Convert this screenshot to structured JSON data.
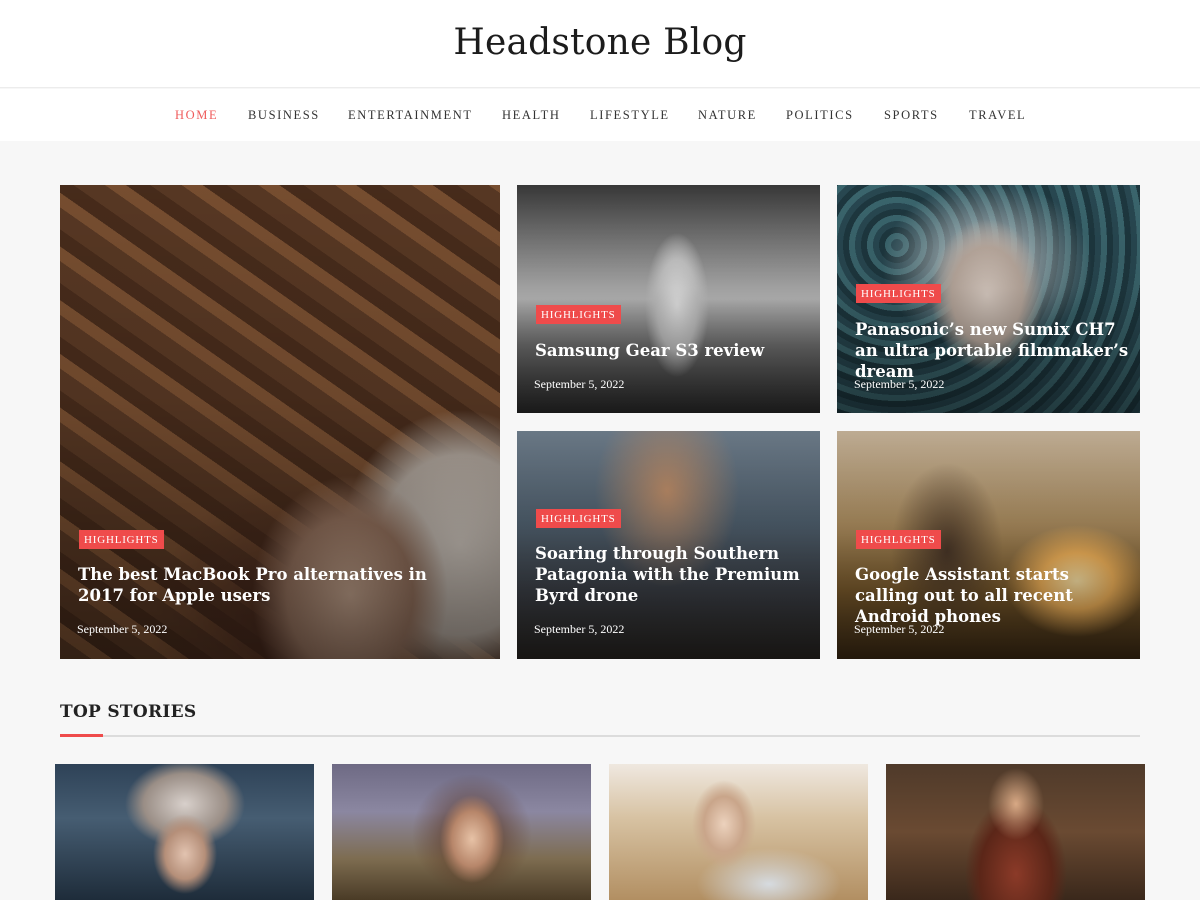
{
  "site": {
    "title": "Headstone Blog"
  },
  "nav": {
    "items": [
      {
        "label": "HOME",
        "active": true
      },
      {
        "label": "BUSINESS",
        "active": false
      },
      {
        "label": "ENTERTAINMENT",
        "active": false
      },
      {
        "label": "HEALTH",
        "active": false
      },
      {
        "label": "LIFESTYLE",
        "active": false
      },
      {
        "label": "NATURE",
        "active": false
      },
      {
        "label": "POLITICS",
        "active": false
      },
      {
        "label": "SPORTS",
        "active": false
      },
      {
        "label": "TRAVEL",
        "active": false
      }
    ]
  },
  "featured": [
    {
      "category": "HIGHLIGHTS",
      "title": "The best MacBook Pro alternatives in 2017 for Apple users",
      "date": "September 5, 2022"
    },
    {
      "category": "HIGHLIGHTS",
      "title": "Samsung Gear S3 review",
      "date": "September 5, 2022"
    },
    {
      "category": "HIGHLIGHTS",
      "title": "Panasonic’s new Sumix CH7 an ultra portable filmmaker’s dream",
      "date": "September 5, 2022"
    },
    {
      "category": "HIGHLIGHTS",
      "title": "Soaring through Southern Patagonia with the Premium Byrd drone",
      "date": "September 5, 2022"
    },
    {
      "category": "HIGHLIGHTS",
      "title": "Google Assistant starts calling out to all recent Android phones",
      "date": "September 5, 2022"
    }
  ],
  "top_stories": {
    "heading": "TOP STORIES"
  },
  "colors": {
    "accent": "#ef4b4b",
    "nav_active": "#ef5a5a",
    "background": "#f7f7f7"
  }
}
